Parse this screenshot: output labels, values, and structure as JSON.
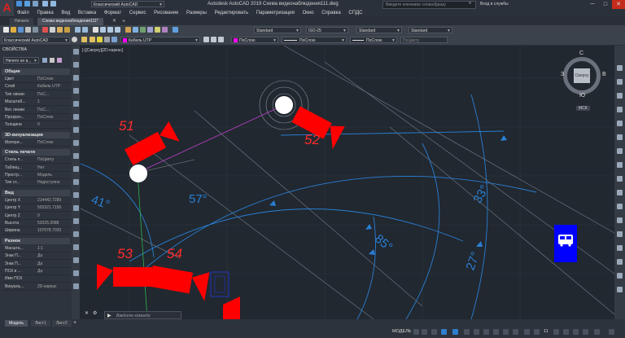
{
  "app": {
    "logo": "A",
    "workspace": "Классический AutoCAD",
    "title": "Autodesk AutoCAD 2019   Схема видеонаблюдения111.dwg",
    "search_placeholder": "Введите ключевое слово/фразу",
    "signin": "Вход в службы"
  },
  "menu": [
    "Файл",
    "Правка",
    "Вид",
    "Вставка",
    "Формат",
    "Сервис",
    "Рисование",
    "Размеры",
    "Редактировать",
    "Параметризация",
    "Окно",
    "Справка",
    "СПДС"
  ],
  "tabs": [
    {
      "label": "Начало"
    },
    {
      "label": "Схема видеонаблюдения111*"
    }
  ],
  "toolbar": {
    "workspace_combo": "Классический AutoCAD",
    "layer_combo": "Кабель UTP",
    "color_combo": "ПоСлою",
    "linetype_combo": "ПоСлою",
    "lineweight_combo": "ПоСлою",
    "plotstyle_combo": "ПоЦвету",
    "textstyle_combo": "Standard",
    "dimstyle_combo": "ISO-25",
    "tablestyle_combo": "Standard",
    "mleaderstyle_combo": "Standard"
  },
  "properties": {
    "title": "СВОЙСТВА",
    "selection": "Ничего не в...",
    "sections": [
      {
        "name": "Общие",
        "rows": [
          {
            "k": "Цвет",
            "v": "ПоСлою"
          },
          {
            "k": "Слой",
            "v": "Кабель UTP"
          },
          {
            "k": "Тип линии",
            "v": "ПоС..."
          },
          {
            "k": "Масштаб...",
            "v": "1"
          },
          {
            "k": "Вес линии",
            "v": "ПоС..."
          },
          {
            "k": "Прозрач...",
            "v": "ПоСлою"
          },
          {
            "k": "Толщина",
            "v": "0"
          }
        ]
      },
      {
        "name": "3D-визуализация",
        "rows": [
          {
            "k": "Матери...",
            "v": "ПоСлою"
          }
        ]
      },
      {
        "name": "Стиль печати",
        "rows": [
          {
            "k": "Стиль п...",
            "v": "ПоЦвету"
          },
          {
            "k": "Таблиц...",
            "v": "Нет"
          },
          {
            "k": "Простр...",
            "v": "Модель"
          },
          {
            "k": "Тип ст...",
            "v": "Недоступно"
          }
        ]
      },
      {
        "name": "Вид",
        "rows": [
          {
            "k": "Центр X",
            "v": "214442.7289"
          },
          {
            "k": "Центр Y",
            "v": "503321.7156"
          },
          {
            "k": "Центр Z",
            "v": "0"
          },
          {
            "k": "Высота",
            "v": "52025.3088"
          },
          {
            "k": "Ширина",
            "v": "107078.7020"
          }
        ]
      },
      {
        "name": "Разное",
        "rows": [
          {
            "k": "Масшта...",
            "v": "1:1"
          },
          {
            "k": "Знак П...",
            "v": "Да"
          },
          {
            "k": "Знак П...",
            "v": "Да"
          },
          {
            "k": "ПСК в ...",
            "v": "Да"
          },
          {
            "k": "Имя ПСК",
            "v": ""
          },
          {
            "k": "Визуаль...",
            "v": "2D-каркас"
          }
        ]
      }
    ]
  },
  "viewport": {
    "label": "[-][Сверху][2D-каркас]",
    "viewcube": {
      "top": "С",
      "bottom": "Ю",
      "left": "З",
      "right": "В",
      "face": "Сверху",
      "ucs": "МСК"
    },
    "cameras": [
      "51",
      "52",
      "53",
      "54"
    ],
    "angles": [
      "41°",
      "57°",
      "85°",
      "33°",
      "27°"
    ]
  },
  "command": {
    "placeholder": "Введите команду"
  },
  "layouts": [
    "Модель",
    "Лист1",
    "Лист2"
  ],
  "status": {
    "model": "МОДЕЛЬ",
    "scale": "11"
  },
  "colors": {
    "accent_red": "#ff0000",
    "dim_blue": "#1e7bd8",
    "bus_blue": "#0000ff"
  }
}
